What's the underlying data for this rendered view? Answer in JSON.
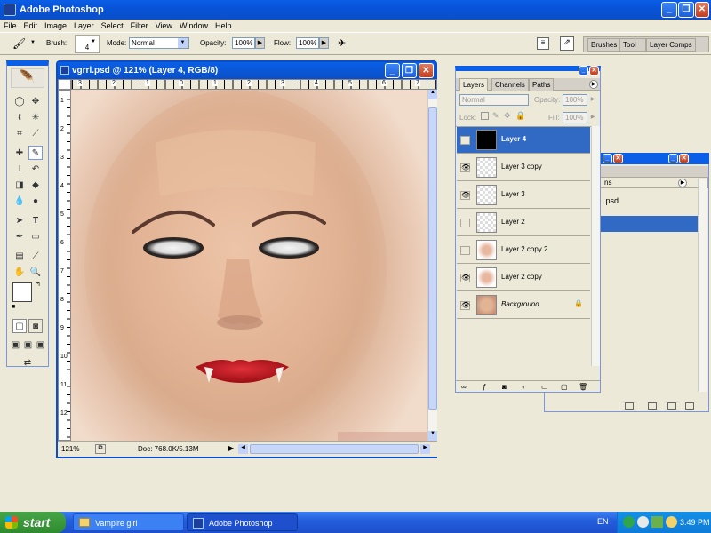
{
  "app": {
    "title": "Adobe Photoshop"
  },
  "menu": [
    "File",
    "Edit",
    "Image",
    "Layer",
    "Select",
    "Filter",
    "View",
    "Window",
    "Help"
  ],
  "options": {
    "brush_label": "Brush:",
    "brush_size": "4",
    "mode_label": "Mode:",
    "mode_value": "Normal",
    "opacity_label": "Opacity:",
    "opacity_value": "100%",
    "flow_label": "Flow:",
    "flow_value": "100%",
    "palette_tabs": [
      "Brushes",
      "Tool Pr",
      "Layer Comps"
    ]
  },
  "document": {
    "title": "vgrrl.psd @ 121% (Layer 4, RGB/8)",
    "zoom": "121%",
    "doc_info": "Doc: 768.0K/5.13M",
    "ruler_h": [
      "3",
      "2",
      "1",
      "0",
      "1",
      "2",
      "3",
      "4",
      "5",
      "6",
      "7"
    ],
    "ruler_v": [
      "1",
      "2",
      "3",
      "4",
      "5",
      "6",
      "7",
      "8",
      "9",
      "10",
      "11",
      "12"
    ]
  },
  "layers_panel": {
    "tabs": [
      "Layers",
      "Channels",
      "Paths"
    ],
    "blend_mode": "Normal",
    "opacity_label": "Opacity:",
    "opacity_value": "100%",
    "lock_label": "Lock:",
    "fill_label": "Fill:",
    "fill_value": "100%",
    "layers": [
      {
        "name": "Layer 4",
        "visible": false,
        "selected": true
      },
      {
        "name": "Layer 3 copy",
        "visible": true,
        "selected": false
      },
      {
        "name": "Layer 3",
        "visible": true,
        "selected": false
      },
      {
        "name": "Layer 2",
        "visible": false,
        "selected": false
      },
      {
        "name": "Layer 2 copy 2",
        "visible": false,
        "selected": false
      },
      {
        "name": "Layer 2 copy",
        "visible": true,
        "selected": false
      },
      {
        "name": "Background",
        "visible": true,
        "selected": false
      }
    ]
  },
  "bg_panel": {
    "tab_partial": "ns",
    "file_partial": ".psd"
  },
  "taskbar": {
    "start_label": "start",
    "items": [
      "Vampire girl",
      "Adobe Photoshop"
    ],
    "lang": "EN",
    "time": "3:49 PM"
  },
  "colors": {
    "xp_blue": "#0A5FE6",
    "selection": "#316AC5",
    "lips": "#C8121A"
  }
}
